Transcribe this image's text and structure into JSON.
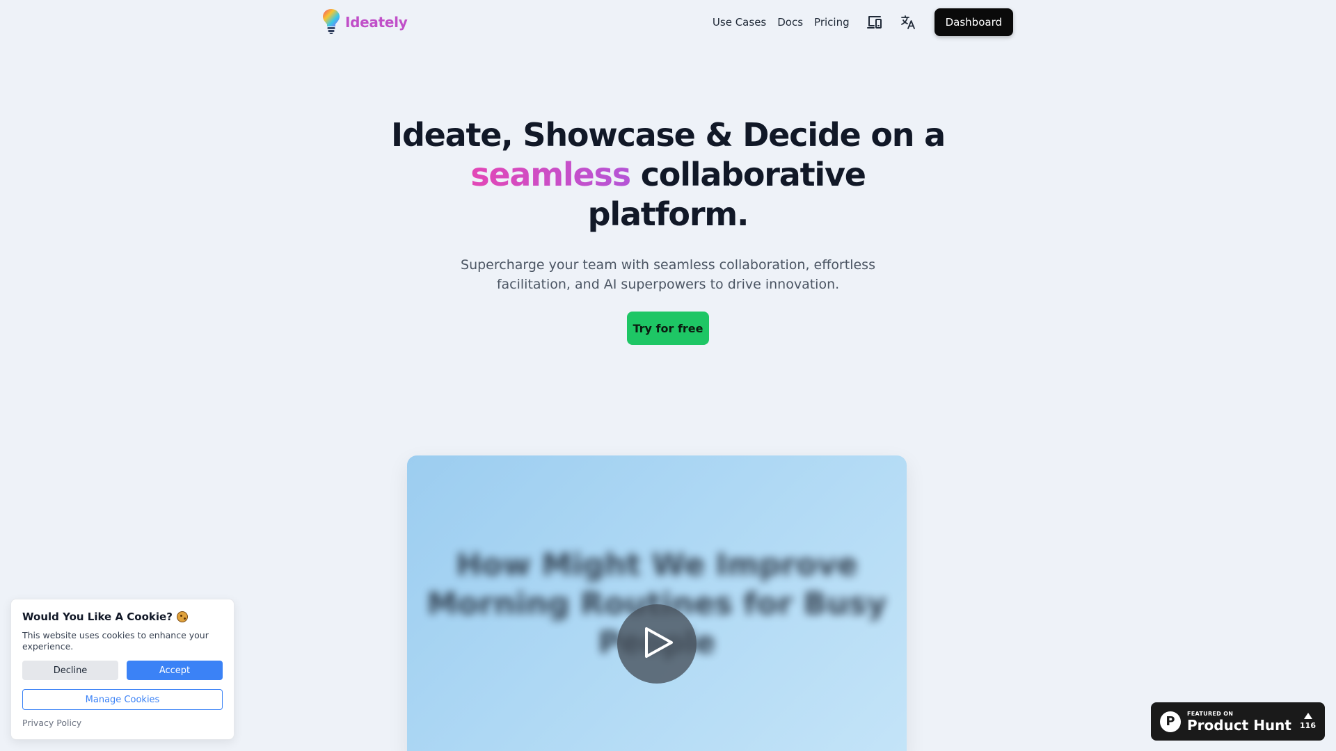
{
  "header": {
    "logo_text": "Ideately",
    "nav": [
      {
        "label": "Use Cases"
      },
      {
        "label": "Docs"
      },
      {
        "label": "Pricing"
      }
    ],
    "icons": [
      "devices-icon",
      "translate-icon"
    ],
    "dashboard_label": "Dashboard"
  },
  "hero": {
    "title_part1": "Ideate, Showcase & Decide on a ",
    "title_accent": "seamless",
    "title_part2": " collaborative platform.",
    "subtitle": "Supercharge your team with seamless collaboration, effortless facilitation, and AI superpowers to drive innovation.",
    "cta_label": "Try for free",
    "accent_color": "#d84dc0"
  },
  "video": {
    "blurred_text": "How Might We Improve Morning Routines for Busy People"
  },
  "cookie": {
    "title": "Would You Like A Cookie?",
    "text": "This website uses cookies to enhance your experience.",
    "decline_label": "Decline",
    "accept_label": "Accept",
    "manage_label": "Manage Cookies",
    "privacy_label": "Privacy Policy"
  },
  "product_hunt": {
    "small": "FEATURED ON",
    "big": "Product Hunt",
    "votes": "116"
  },
  "colors": {
    "background": "#eef2f8",
    "cta": "#1ec665",
    "accept": "#3b82f6",
    "dashboard": "#0a0a0a"
  }
}
